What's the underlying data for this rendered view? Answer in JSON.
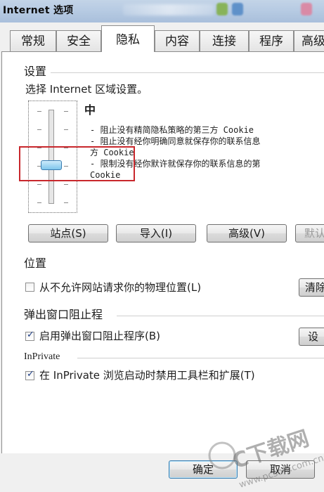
{
  "window": {
    "title": "Internet 选项"
  },
  "tabs": [
    {
      "label": "常规"
    },
    {
      "label": "安全"
    },
    {
      "label": "隐私"
    },
    {
      "label": "内容"
    },
    {
      "label": "连接"
    },
    {
      "label": "程序"
    },
    {
      "label": "高级"
    }
  ],
  "active_tab": "隐私",
  "settings": {
    "group_title": "设置",
    "prompt": "选择 Internet 区域设置。",
    "level": "中",
    "descriptions": [
      "- 阻止没有精简隐私策略的第三方 Cookie",
      "- 阻止没有经你明确同意就保存你的联系信息",
      "方 Cookie",
      "- 限制没有经你默许就保存你的联系信息的第",
      "Cookie"
    ],
    "buttons": {
      "sites": "站点(S)",
      "import": "导入(I)",
      "advanced": "高级(V)",
      "default": "默认"
    }
  },
  "location": {
    "group_title": "位置",
    "checkbox_label": "从不允许网站请求你的物理位置(L)",
    "checked": false,
    "clear_button": "清除"
  },
  "popup": {
    "group_title": "弹出窗口阻止程",
    "checkbox_label": "启用弹出窗口阻止程序(B)",
    "checked": true,
    "settings_button": "设"
  },
  "inprivate": {
    "group_title": "InPrivate",
    "checkbox_label": "在 InPrivate 浏览启动时禁用工具栏和扩展(T)",
    "checked": true
  },
  "footer": {
    "ok": "确定",
    "cancel": "取消"
  },
  "watermark": {
    "text": "C下载网",
    "url": "www.pcsoft.com.cn"
  },
  "colors": {
    "highlight_border": "#c8272c",
    "titlebar": "#b7cbe3",
    "slider_thumb": "#7ec5ec"
  }
}
